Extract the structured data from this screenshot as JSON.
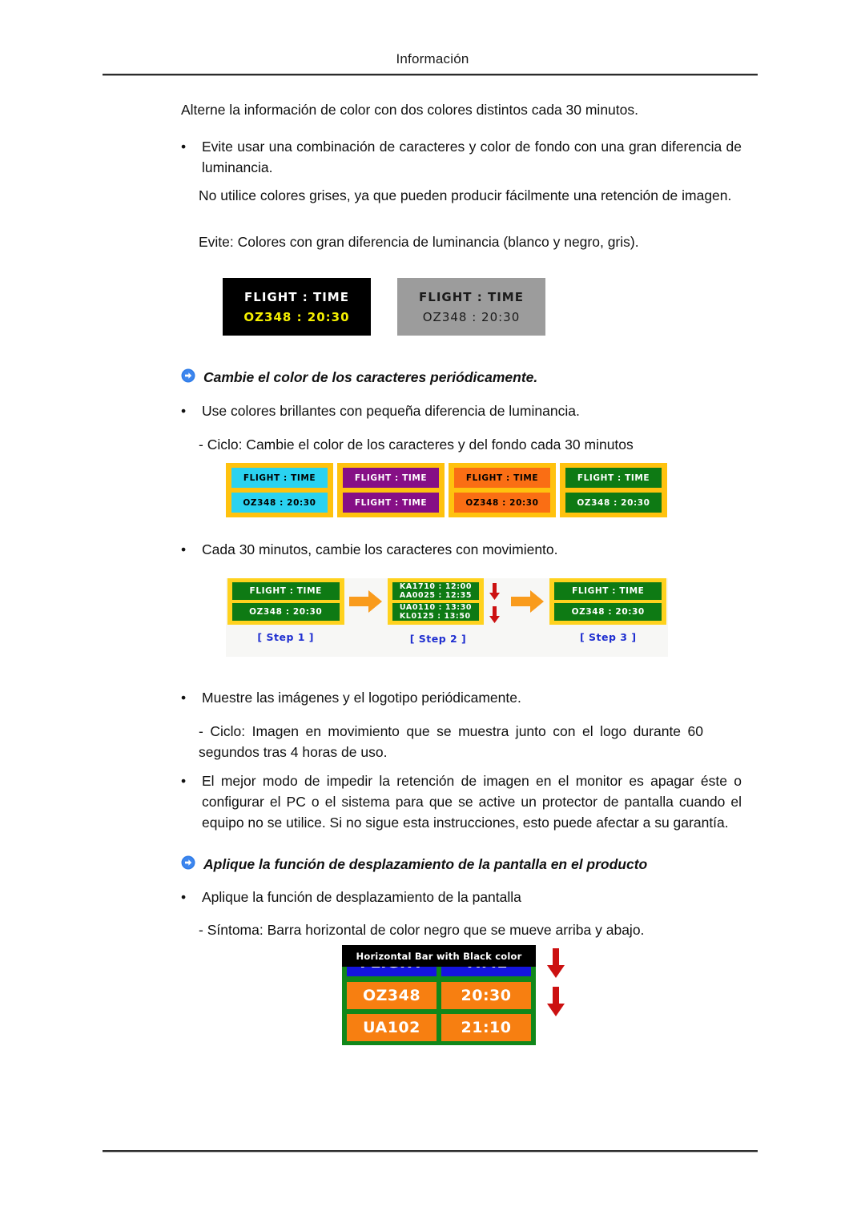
{
  "header": {
    "title": "Información"
  },
  "content": {
    "lead": "Alterne la información de color con dos colores distintos cada 30 minutos.",
    "bullet_1": "Evite usar una combinación de caracteres y color de fondo con una gran diferencia de luminancia.",
    "para_1": "No utilice colores grises, ya que pueden producir fácilmente una retención de imagen.",
    "para_2": "Evite: Colores con gran diferencia de luminancia (blanco y negro, gris).",
    "heading_1": "Cambie el color de los caracteres periódicamente.",
    "bullet_2": "Use colores brillantes con pequeña diferencia de luminancia.",
    "sub_1": "- Ciclo: Cambie el color de los caracteres y del fondo cada 30 minutos",
    "bullet_3": "Cada 30 minutos, cambie los caracteres con movimiento.",
    "bullet_4": "Muestre las imágenes y el logotipo periódicamente.",
    "sub_2": "- Ciclo: Imagen en movimiento que se muestra junto con el logo durante 60 segundos tras 4 horas de uso.",
    "bullet_5": "El mejor modo de impedir la retención de imagen en el monitor es apagar éste o configurar el PC o el sistema para que se active un protector de pantalla cuando el equipo no se utilice. Si no sigue esta instrucciones, esto puede afectar a su garantía.",
    "heading_2": "Aplique la función de desplazamiento de la pantalla en el producto",
    "bullet_6": "Aplique la función de desplazamiento de la pantalla",
    "sub_3": "- Síntoma: Barra horizontal de color negro que se mueve arriba y abajo.",
    "bullet_marker": "•"
  },
  "figure_contrast": {
    "panels": [
      {
        "name": "black-panel",
        "line1": "FLIGHT : TIME",
        "line2": "OZ348  :  20:30",
        "background": "#000000",
        "line1_color": "#ffffff",
        "line2_color": "#f5f000"
      },
      {
        "name": "gray-panel",
        "line1": "FLIGHT : TIME",
        "line2": "OZ348  :  20:30",
        "background": "#9c9c9c",
        "line1_color": "#1b1b1b",
        "line2_color": "#1b1b1b"
      }
    ]
  },
  "figure_cycle": {
    "border_color": "#ffc20e",
    "panels": [
      {
        "bg": "#2ad2f0",
        "fg": "#000000",
        "line1": "FLIGHT : TIME",
        "line2": "OZ348   :  20:30"
      },
      {
        "bg": "#860f86",
        "fg": "#ffffff",
        "line1": "FLIGHT : TIME",
        "line2": "FLIGHT : TIME"
      },
      {
        "bg": "#fa6e14",
        "fg": "#000000",
        "line1": "FLIGHT : TIME",
        "line2": "OZ348   :  20:30"
      },
      {
        "bg": "#0e7a14",
        "fg": "#ffffff",
        "line1": "FLIGHT : TIME",
        "line2": "OZ348   :  20:30"
      }
    ]
  },
  "figure_steps": {
    "border_color": "#ffd21e",
    "cell_bg": "#0e7a14",
    "label_color": "#1f2fd0",
    "arrow_color": "#f99b1c",
    "down_arrow_color": "#cc1111",
    "steps": [
      {
        "label": "[ Step 1 ]",
        "line1": "FLIGHT : TIME",
        "line2": "OZ348   :  20:30",
        "scrolling": false
      },
      {
        "label": "[ Step 2 ]",
        "line1_top": "KA1710  :  12:00",
        "line1_bottom": "AA0025  :  12:35",
        "line2_top": "UA0110  :  13:30",
        "line2_bottom": "KL0125  :  13:50",
        "scrolling": true
      },
      {
        "label": "[ Step 3 ]",
        "line1": "FLIGHT : TIME",
        "line2": "OZ348   :  20:30",
        "scrolling": false
      }
    ]
  },
  "figure_bar": {
    "bar_label": "Horizontal Bar with Black color",
    "screen_bg": "#11871a",
    "header_bg": "#1414e0",
    "cell_bg": "#f77f11",
    "arrow_color": "#cc1111",
    "rows": [
      {
        "left": "FLIGHT",
        "right": "TIME",
        "style": "blue"
      },
      {
        "left": "OZ348",
        "right": "20:30",
        "style": "orange"
      },
      {
        "left": "UA102",
        "right": "21:10",
        "style": "orange"
      }
    ]
  }
}
